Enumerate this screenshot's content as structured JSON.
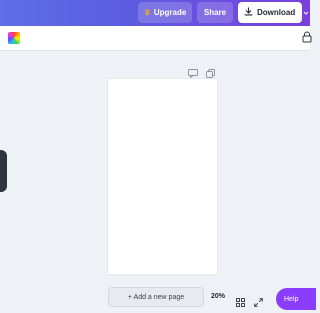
{
  "header": {
    "upgrade_label": "Upgrade",
    "share_label": "Share",
    "download_label": "Download",
    "accent_color": "#6a4fe0"
  },
  "footer": {
    "add_page_label": "+ Add a new page",
    "zoom_label": "20%",
    "help_label": "Help"
  },
  "icons": [
    "crown-icon",
    "download-icon",
    "chevron-down-icon",
    "color-swatch-icon",
    "lock-icon",
    "notes-icon",
    "duplicate-icon",
    "grid-view-icon",
    "fullscreen-icon"
  ]
}
